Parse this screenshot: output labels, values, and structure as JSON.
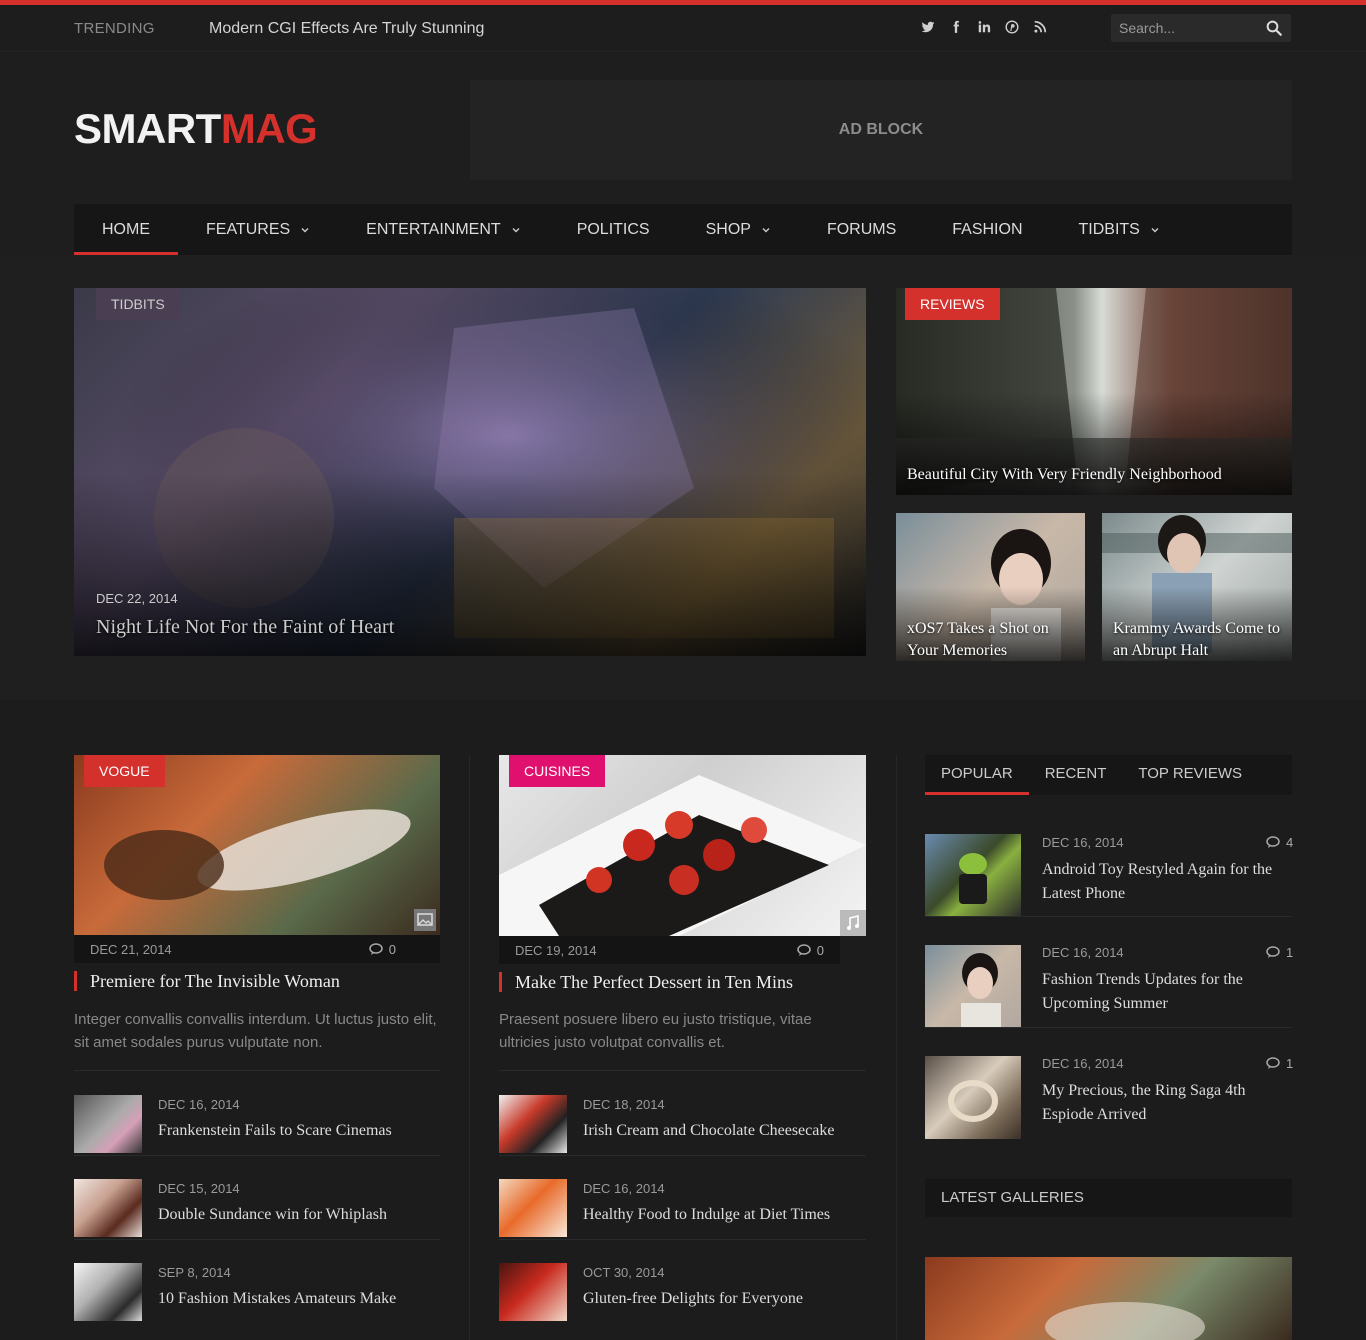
{
  "topbar": {
    "trending_label": "TRENDING",
    "trending_text": "Modern CGI Effects Are Truly Stunning",
    "socials": [
      "twitter-icon",
      "facebook-icon",
      "linkedin-icon",
      "pinterest-icon",
      "rss-icon"
    ],
    "search_placeholder": "Search..."
  },
  "header": {
    "logo_a": "SMART",
    "logo_b": "MAG",
    "ad_text": "AD BLOCK"
  },
  "nav": [
    {
      "label": "HOME",
      "dropdown": false,
      "active": true
    },
    {
      "label": "FEATURES",
      "dropdown": true
    },
    {
      "label": "ENTERTAINMENT",
      "dropdown": true
    },
    {
      "label": "POLITICS",
      "dropdown": false
    },
    {
      "label": "SHOP",
      "dropdown": true
    },
    {
      "label": "FORUMS",
      "dropdown": false
    },
    {
      "label": "FASHION",
      "dropdown": false
    },
    {
      "label": "TIDBITS",
      "dropdown": true
    }
  ],
  "featured": {
    "main": {
      "badge": "TIDBITS",
      "date": "DEC 22, 2014",
      "title": "Night Life Not For the Faint of Heart"
    },
    "right_top": {
      "badge": "REVIEWS",
      "title": "Beautiful City With Very Friendly Neighborhood"
    },
    "right_a": {
      "title": "xOS7 Takes a Shot on Your Memories"
    },
    "right_b": {
      "title": "Krammy Awards Come to an Abrupt Halt"
    }
  },
  "colors": {
    "accent": "#d4302c",
    "vogue": "#d4302c",
    "cuisines": "#e0116e"
  },
  "col1": {
    "badge": "VOGUE",
    "date": "DEC 21, 2014",
    "comments": "0",
    "title": "Premiere for The Invisible Woman",
    "excerpt": "Integer convallis convallis interdum. Ut luctus justo elit, sit amet sodales purus vulputate non.",
    "items": [
      {
        "date": "DEC 16, 2014",
        "title": "Frankenstein Fails to Scare Cinemas"
      },
      {
        "date": "DEC 15, 2014",
        "title": "Double Sundance win for Whiplash"
      },
      {
        "date": "SEP 8, 2014",
        "title": "10 Fashion Mistakes Amateurs Make"
      }
    ]
  },
  "col2": {
    "badge": "CUISINES",
    "date": "DEC 19, 2014",
    "comments": "0",
    "title": "Make The Perfect Dessert in Ten Mins",
    "excerpt": "Praesent posuere libero eu justo tristique, vitae ultricies justo volutpat convallis et.",
    "items": [
      {
        "date": "DEC 18, 2014",
        "title": "Irish Cream and Chocolate Cheesecake"
      },
      {
        "date": "DEC 16, 2014",
        "title": "Healthy Food to Indulge at Diet Times"
      },
      {
        "date": "OCT 30, 2014",
        "title": "Gluten-free Delights for Everyone"
      }
    ]
  },
  "sidebar": {
    "tabs": [
      "POPULAR",
      "RECENT",
      "TOP REVIEWS"
    ],
    "popular": [
      {
        "date": "DEC 16, 2014",
        "comments": "4",
        "title": "Android Toy Restyled Again for the Latest Phone"
      },
      {
        "date": "DEC 16, 2014",
        "comments": "1",
        "title": "Fashion Trends Updates for the Upcoming Summer"
      },
      {
        "date": "DEC 16, 2014",
        "comments": "1",
        "title": "My Precious, the Ring Saga 4th Espiode Arrived"
      }
    ],
    "galleries_heading": "LATEST GALLERIES"
  }
}
